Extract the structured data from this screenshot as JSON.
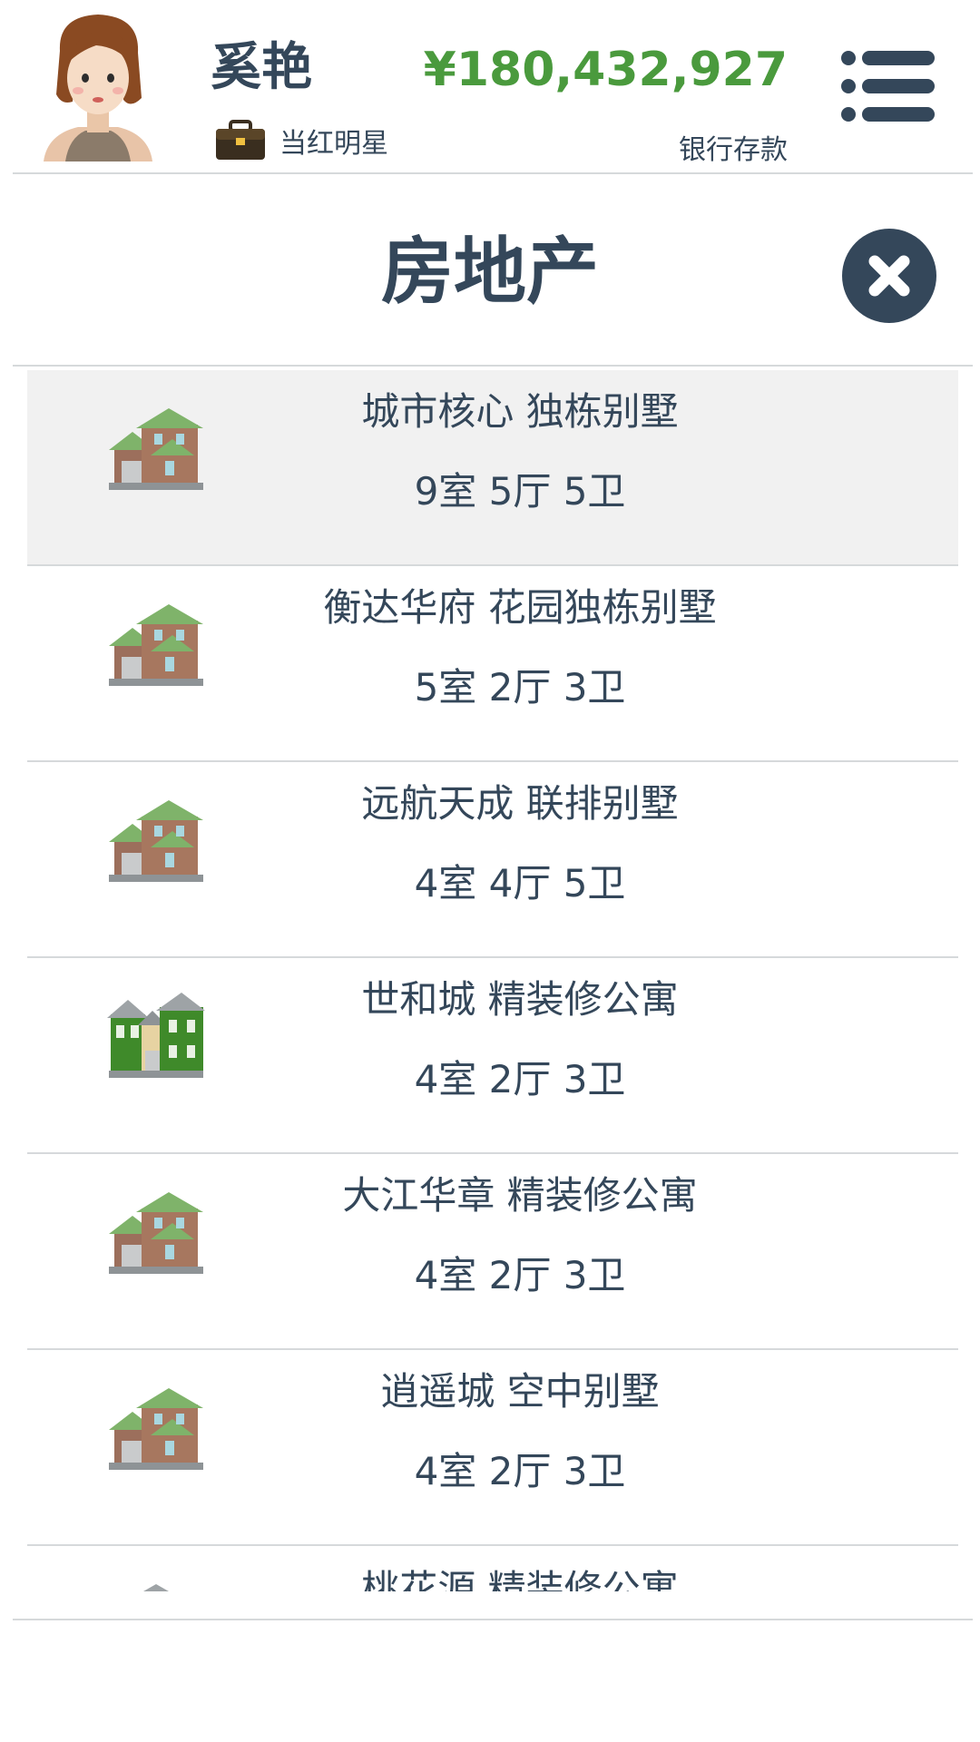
{
  "player": {
    "name": "奚艳",
    "career": "当红明星",
    "balance": "¥180,432,927",
    "balance_label": "银行存款"
  },
  "page": {
    "title": "房地产"
  },
  "colors": {
    "text": "#34475a",
    "money": "#4a9a3d",
    "divider": "#d6d9db",
    "selected_row": "#f1f1f1"
  },
  "properties": [
    {
      "name": "城市核心 独栋别墅",
      "rooms": "9室 5厅 5卫",
      "icon": "brown-house-icon",
      "selected": true
    },
    {
      "name": "衡达华府 花园独栋别墅",
      "rooms": "5室 2厅 3卫",
      "icon": "brown-house-icon",
      "selected": false
    },
    {
      "name": "远航天成 联排别墅",
      "rooms": "4室 4厅 5卫",
      "icon": "brown-house-icon",
      "selected": false
    },
    {
      "name": "世和城 精装修公寓",
      "rooms": "4室 2厅 3卫",
      "icon": "green-house-icon",
      "selected": false
    },
    {
      "name": "大江华章 精装修公寓",
      "rooms": "4室 2厅 3卫",
      "icon": "brown-house-icon",
      "selected": false
    },
    {
      "name": "逍遥城 空中别墅",
      "rooms": "4室 2厅 3卫",
      "icon": "brown-house-icon",
      "selected": false
    },
    {
      "name": "桃花源 精装修公寓",
      "rooms": "",
      "icon": "gray-house-icon",
      "selected": false
    }
  ]
}
